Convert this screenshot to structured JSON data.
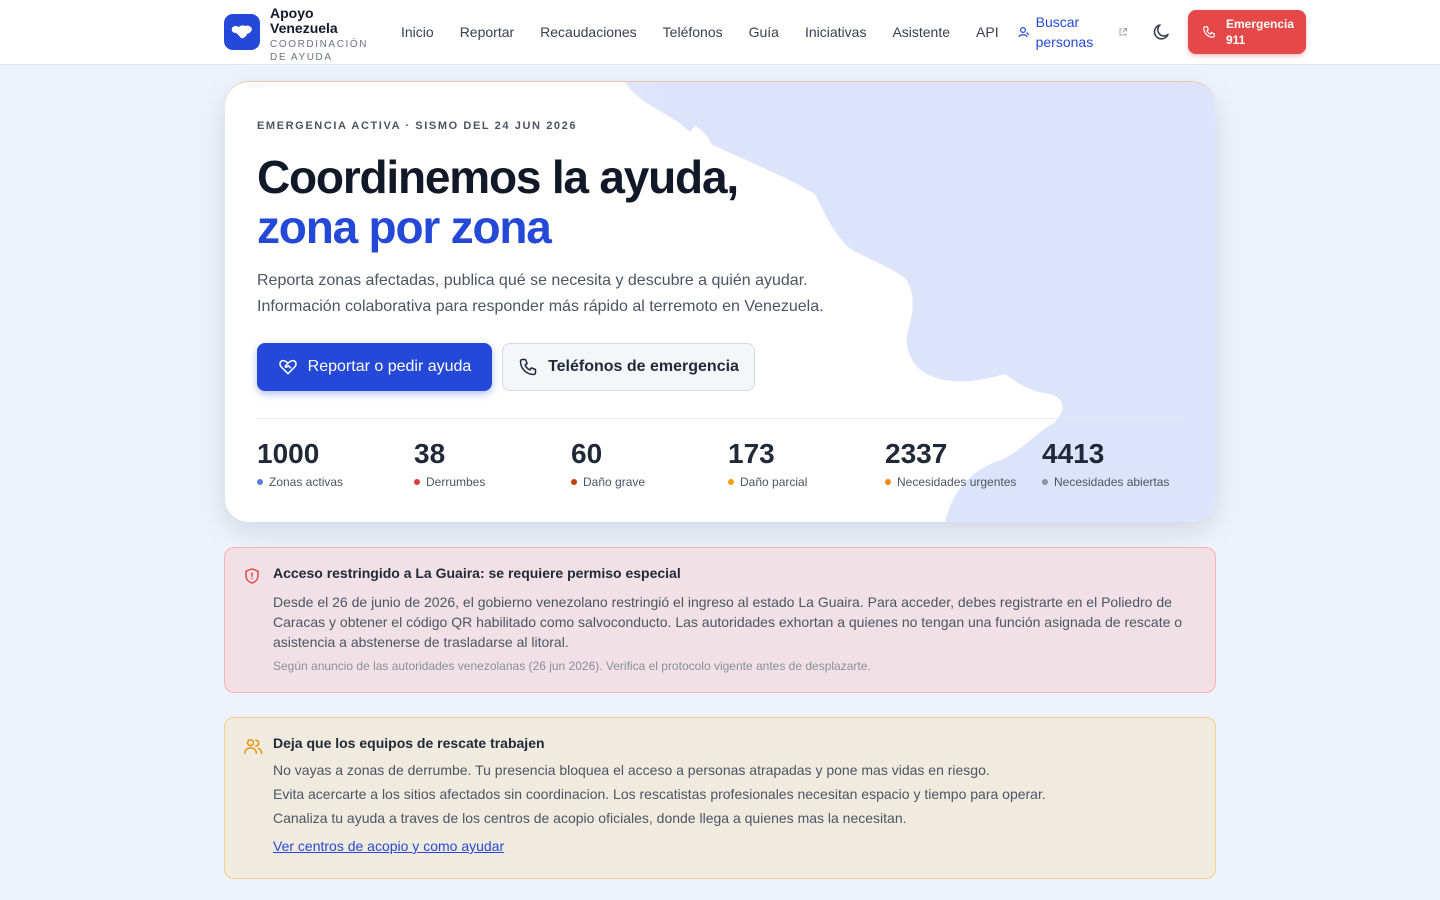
{
  "brand": {
    "name": "Apoyo Venezuela",
    "subtitle": "COORDINACIÓN DE AYUDA",
    "logo_icon": "venezuela-map-icon"
  },
  "nav": {
    "items": [
      {
        "label": "Inicio"
      },
      {
        "label": "Reportar"
      },
      {
        "label": "Recaudaciones"
      },
      {
        "label": "Teléfonos"
      },
      {
        "label": "Guía"
      },
      {
        "label": "Iniciativas"
      },
      {
        "label": "Asistente"
      },
      {
        "label": "API"
      }
    ],
    "search_people": "Buscar personas",
    "emergency_button": "Emergencia 911"
  },
  "hero": {
    "kicker": "EMERGENCIA ACTIVA · SISMO DEL 24 JUN 2026",
    "title_main": "Coordinemos la ayuda, ",
    "title_accent": "zona por zona",
    "description": "Reporta zonas afectadas, publica qué se necesita y descubre a quién ayudar. Información colaborativa para responder más rápido al terremoto en Venezuela.",
    "primary_button": "Reportar o pedir ayuda",
    "secondary_button": "Teléfonos de emergencia"
  },
  "stats": [
    {
      "value": "1000",
      "label": "Zonas activas",
      "color": "#5b7fe0"
    },
    {
      "value": "38",
      "label": "Derrumbes",
      "color": "#dc3b3b"
    },
    {
      "value": "60",
      "label": "Daño grave",
      "color": "#c2410c"
    },
    {
      "value": "173",
      "label": "Daño parcial",
      "color": "#f59e0b"
    },
    {
      "value": "2337",
      "label": "Necesidades urgentes",
      "color": "#f08a1c"
    },
    {
      "value": "4413",
      "label": "Necesidades abiertas",
      "color": "#8b93a1"
    }
  ],
  "alert_restricted": {
    "title": "Acceso restringido a La Guaira: se requiere permiso especial",
    "body": "Desde el 26 de junio de 2026, el gobierno venezolano restringió el ingreso al estado La Guaira. Para acceder, debes registrarte en el Poliedro de Caracas y obtener el código QR habilitado como salvoconducto. Las autoridades exhortan a quienes no tengan una función asignada de rescate o asistencia a abstenerse de trasladarse al litoral.",
    "note": "Según anuncio de las autoridades venezolanas (26 jun 2026). Verifica el protocolo vigente antes de desplazarte.",
    "color": "#dc3b3b"
  },
  "alert_rescue": {
    "title": "Deja que los equipos de rescate trabajen",
    "lines": [
      "No vayas a zonas de derrumbe. Tu presencia bloquea el acceso a personas atrapadas y pone mas vidas en riesgo.",
      "Evita acercarte a los sitios afectados sin coordinacion. Los rescatistas profesionales necesitan espacio y tiempo para operar.",
      "Canaliza tu ayuda a traves de los centros de acopio oficiales, donde llega a quienes mas la necesitan."
    ],
    "link": "Ver centros de acopio y como ayudar",
    "color": "#e8910c"
  },
  "colors": {
    "accent": "#2449d8",
    "emergency": "#e54848",
    "map_fill": "#dbe4fb"
  }
}
